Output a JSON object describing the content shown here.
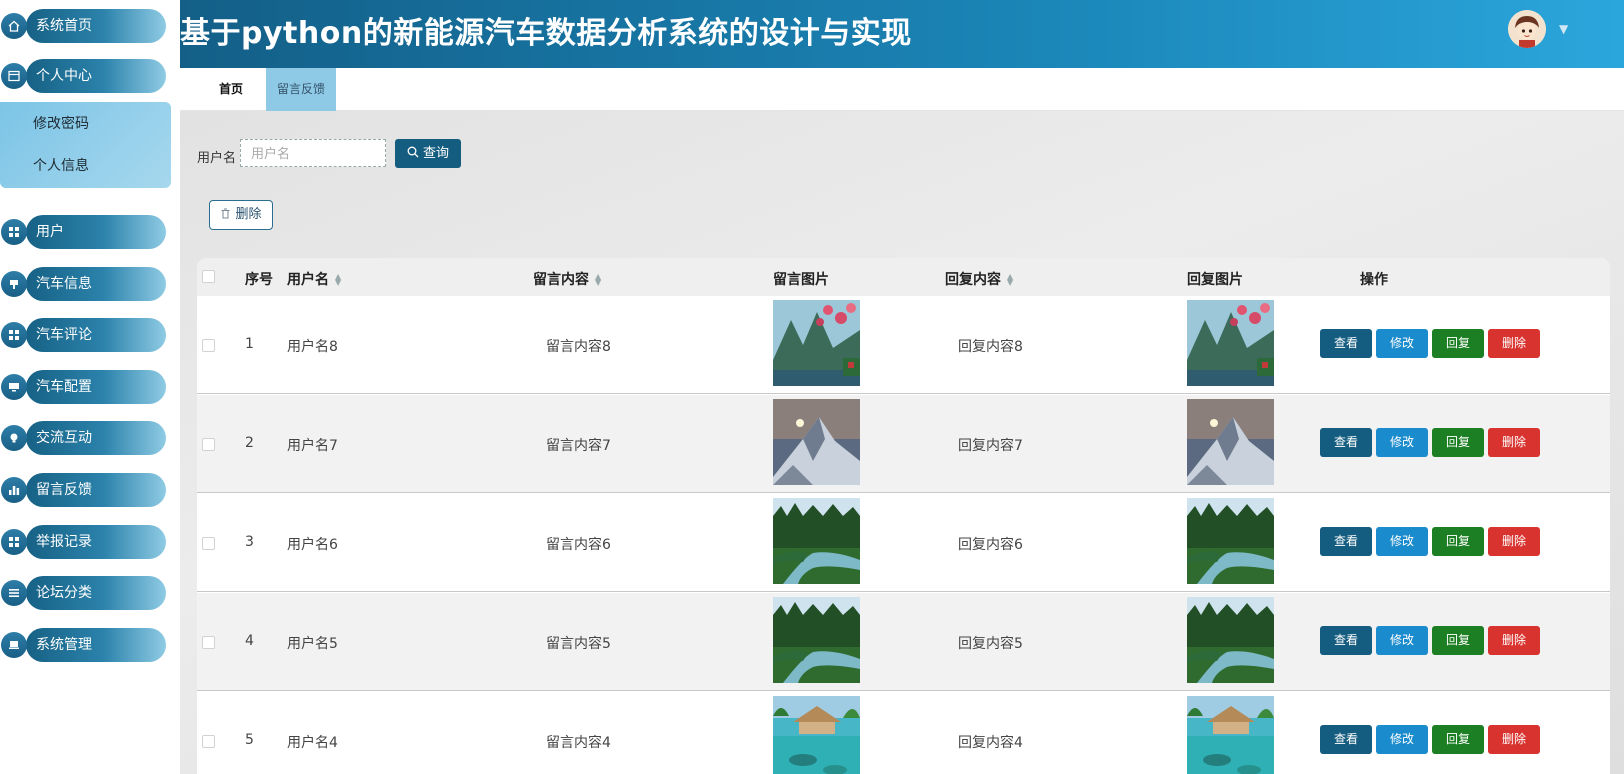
{
  "app": {
    "title": "基于python的新能源汽车数据分析系统的设计与实现"
  },
  "sidebar": {
    "items": [
      {
        "label": "系统首页",
        "icon": "home-icon"
      },
      {
        "label": "个人中心",
        "icon": "profile-card-icon"
      },
      {
        "label": "用户",
        "icon": "grid-icon"
      },
      {
        "label": "汽车信息",
        "icon": "car-info-icon"
      },
      {
        "label": "汽车评论",
        "icon": "grid-icon"
      },
      {
        "label": "汽车配置",
        "icon": "monitor-icon"
      },
      {
        "label": "交流互动",
        "icon": "bulb-icon"
      },
      {
        "label": "留言反馈",
        "icon": "bar-chart-icon"
      },
      {
        "label": "举报记录",
        "icon": "grid-icon"
      },
      {
        "label": "论坛分类",
        "icon": "list-icon"
      },
      {
        "label": "系统管理",
        "icon": "laptop-icon"
      }
    ],
    "submenu": [
      "修改密码",
      "个人信息"
    ]
  },
  "tabs": [
    {
      "label": "首页"
    },
    {
      "label": "留言反馈"
    }
  ],
  "search": {
    "label": "用户名",
    "placeholder": "用户名",
    "button": "查询"
  },
  "toolbar": {
    "delete_label": "删除"
  },
  "table": {
    "headers": {
      "index": "序号",
      "username": "用户名",
      "content": "留言内容",
      "image": "留言图片",
      "reply": "回复内容",
      "reply_image": "回复图片",
      "actions": "操作"
    },
    "rows": [
      {
        "index": "1",
        "username": "用户名8",
        "content": "留言内容8",
        "reply": "回复内容8",
        "image": "mountain-blossom"
      },
      {
        "index": "2",
        "username": "用户名7",
        "content": "留言内容7",
        "reply": "回复内容7",
        "image": "snow-mountain-moon"
      },
      {
        "index": "3",
        "username": "用户名6",
        "content": "留言内容6",
        "reply": "回复内容6",
        "image": "forest-river"
      },
      {
        "index": "4",
        "username": "用户名5",
        "content": "留言内容5",
        "reply": "回复内容5",
        "image": "forest-river"
      },
      {
        "index": "5",
        "username": "用户名4",
        "content": "留言内容4",
        "reply": "回复内容4",
        "image": "tropical-hut"
      }
    ],
    "actions": [
      "查看",
      "修改",
      "回复",
      "删除"
    ]
  },
  "colors": {
    "header": "#1b86b8",
    "view": "#155d80",
    "edit": "#1a8bcc",
    "reply": "#1d7f23",
    "delete": "#d8332e"
  }
}
